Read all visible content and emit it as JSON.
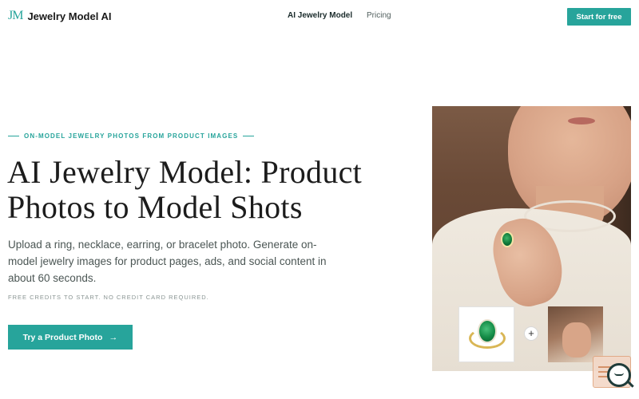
{
  "header": {
    "logo_mark": "JM",
    "brand": "Jewelry Model AI",
    "nav": [
      "AI Jewelry Model",
      "Pricing"
    ],
    "cta": "Start for free"
  },
  "hero": {
    "eyebrow": "ON-MODEL JEWELRY PHOTOS FROM PRODUCT IMAGES",
    "title": "AI Jewelry Model: Product Photos to Model Shots",
    "description": "Upload a ring, necklace, earring, or bracelet photo. Generate on-model jewelry images for product pages, ads, and social content in about 60 seconds.",
    "note": "FREE CREDITS TO START. NO CREDIT CARD REQUIRED.",
    "button": "Try a Product Photo",
    "button_icon": "arrow-right-icon"
  },
  "visual": {
    "main_image": "model-wearing-emerald-ring-photo",
    "thumbnail_product": "emerald-ring-product-photo",
    "thumbnail_model": "hand-model-photo",
    "combine_icon": "plus-icon"
  },
  "colors": {
    "accent": "#27a49b",
    "text_dark": "#1c1c1c",
    "text_muted": "#4b5654"
  }
}
